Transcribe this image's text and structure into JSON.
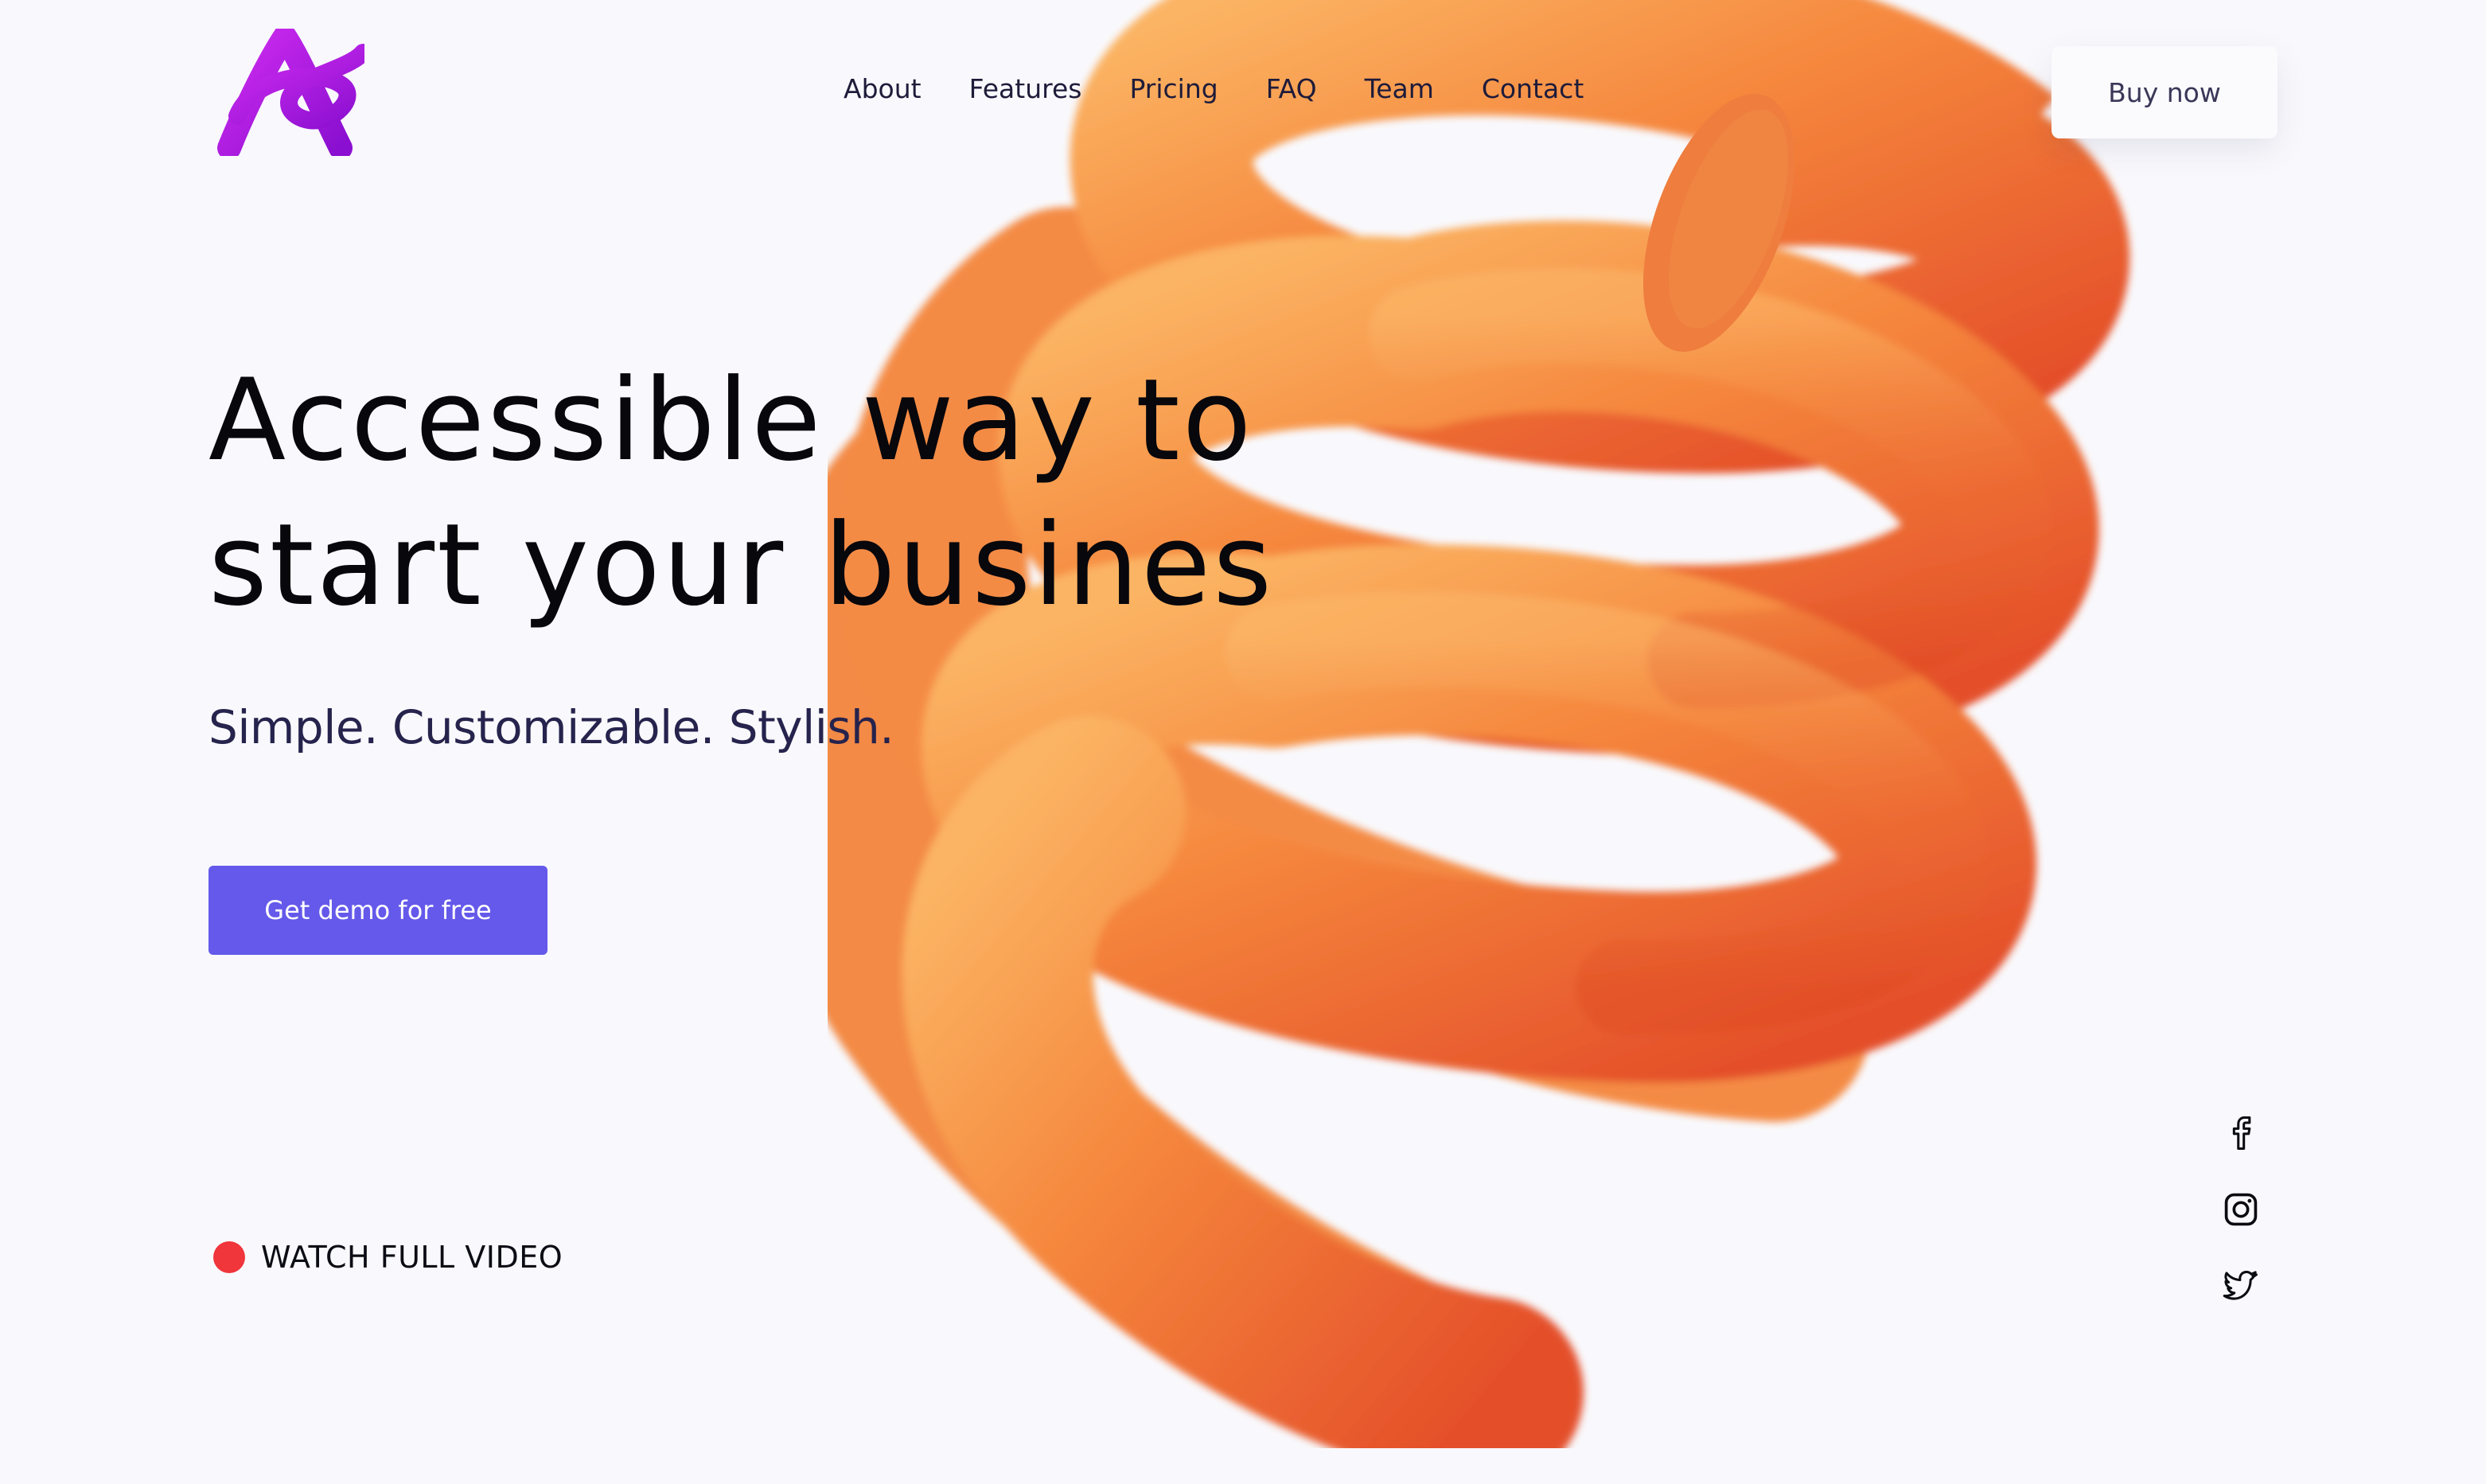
{
  "brand": {
    "logo_letter": "A",
    "logo_color": "#b61ee0"
  },
  "nav": {
    "items": [
      {
        "label": "About"
      },
      {
        "label": "Features"
      },
      {
        "label": "Pricing"
      },
      {
        "label": "FAQ"
      },
      {
        "label": "Team"
      },
      {
        "label": "Contact"
      }
    ],
    "cta_label": "Buy now"
  },
  "hero": {
    "title_line1": "Accessible way to",
    "title_line2": "start your busines",
    "tagline": "Simple. Customizable. Stylish.",
    "demo_button": "Get demo for free",
    "watch_label": "WATCH FULL VIDEO"
  },
  "social": {
    "icons": [
      "facebook-icon",
      "instagram-icon",
      "twitter-icon"
    ]
  },
  "colors": {
    "background": "#f9f9fd",
    "accent": "#6459ea",
    "record_dot": "#f0353b",
    "spring_light": "#fbb463",
    "spring_dark": "#e6522a",
    "text_dark": "#07070c",
    "text_navy": "#26234d"
  }
}
